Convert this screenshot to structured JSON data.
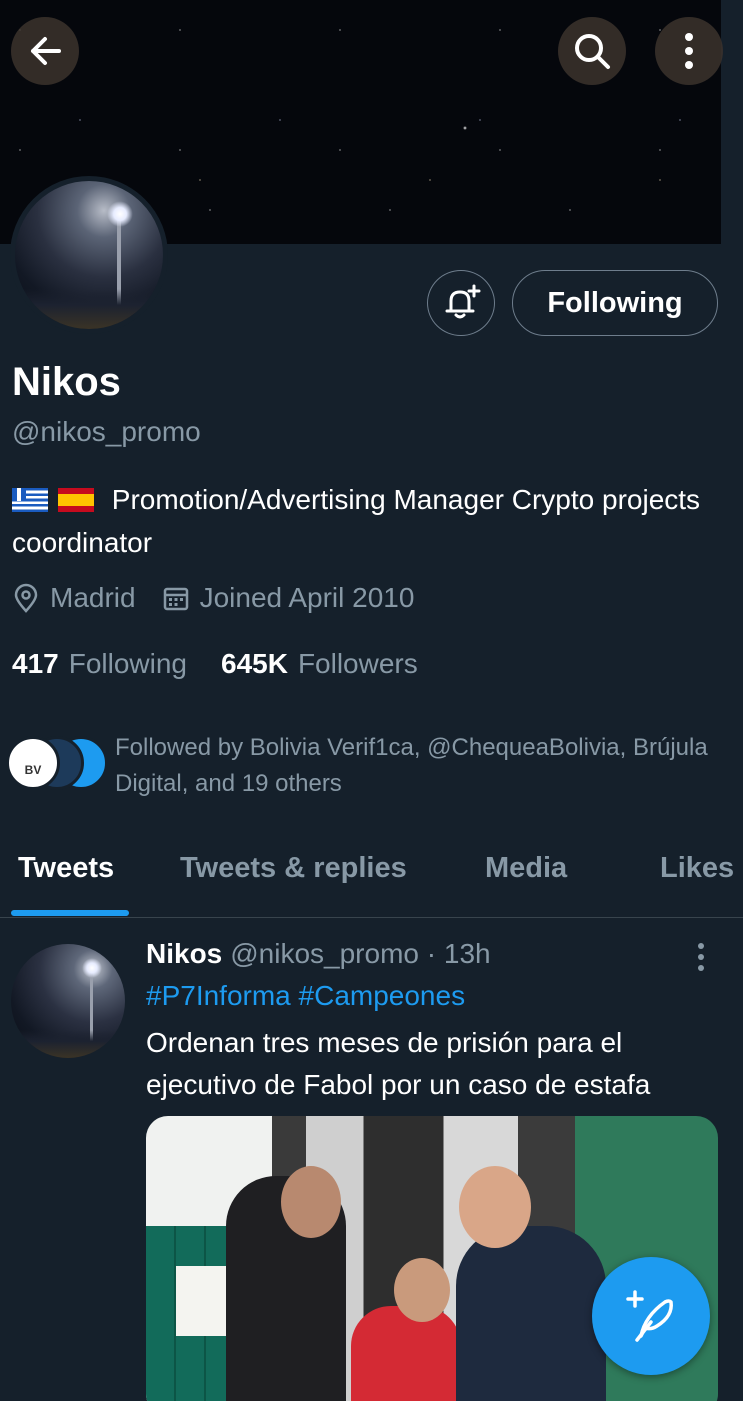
{
  "header": {
    "back_icon": "arrow-left-icon",
    "search_icon": "search-icon",
    "more_icon": "more-vertical-icon"
  },
  "profile": {
    "name": "Nikos",
    "handle": "@nikos_promo",
    "bio": "Promotion/Advertising Manager Crypto projects coordinator",
    "bio_flags": [
      "greece-flag",
      "spain-flag"
    ],
    "location": "Madrid",
    "joined": "Joined April 2010",
    "following_count": "417",
    "following_label": "Following",
    "followers_count": "645K",
    "followers_label": "Followers",
    "follow_button_label": "Following",
    "followed_by": "Followed by Bolivia Verif1ca, @ChequeaBolivia, Brújula Digital, and 19 others",
    "followed_by_first_avatar_text": "BV"
  },
  "tabs": [
    {
      "label": "Tweets",
      "active": true
    },
    {
      "label": "Tweets & replies",
      "active": false
    },
    {
      "label": "Media",
      "active": false
    },
    {
      "label": "Likes",
      "active": false
    }
  ],
  "tweet": {
    "author_name": "Nikos",
    "author_handle": "@nikos_promo",
    "time": "· 13h",
    "hashtags": "#P7Informa #Campeones",
    "text": "Ordenan tres meses de prisión para el ejecutivo de Fabol por un caso de estafa"
  },
  "colors": {
    "background": "#15202b",
    "accent": "#1d9bf0",
    "secondary_text": "#8899a6",
    "border": "#38444d"
  }
}
